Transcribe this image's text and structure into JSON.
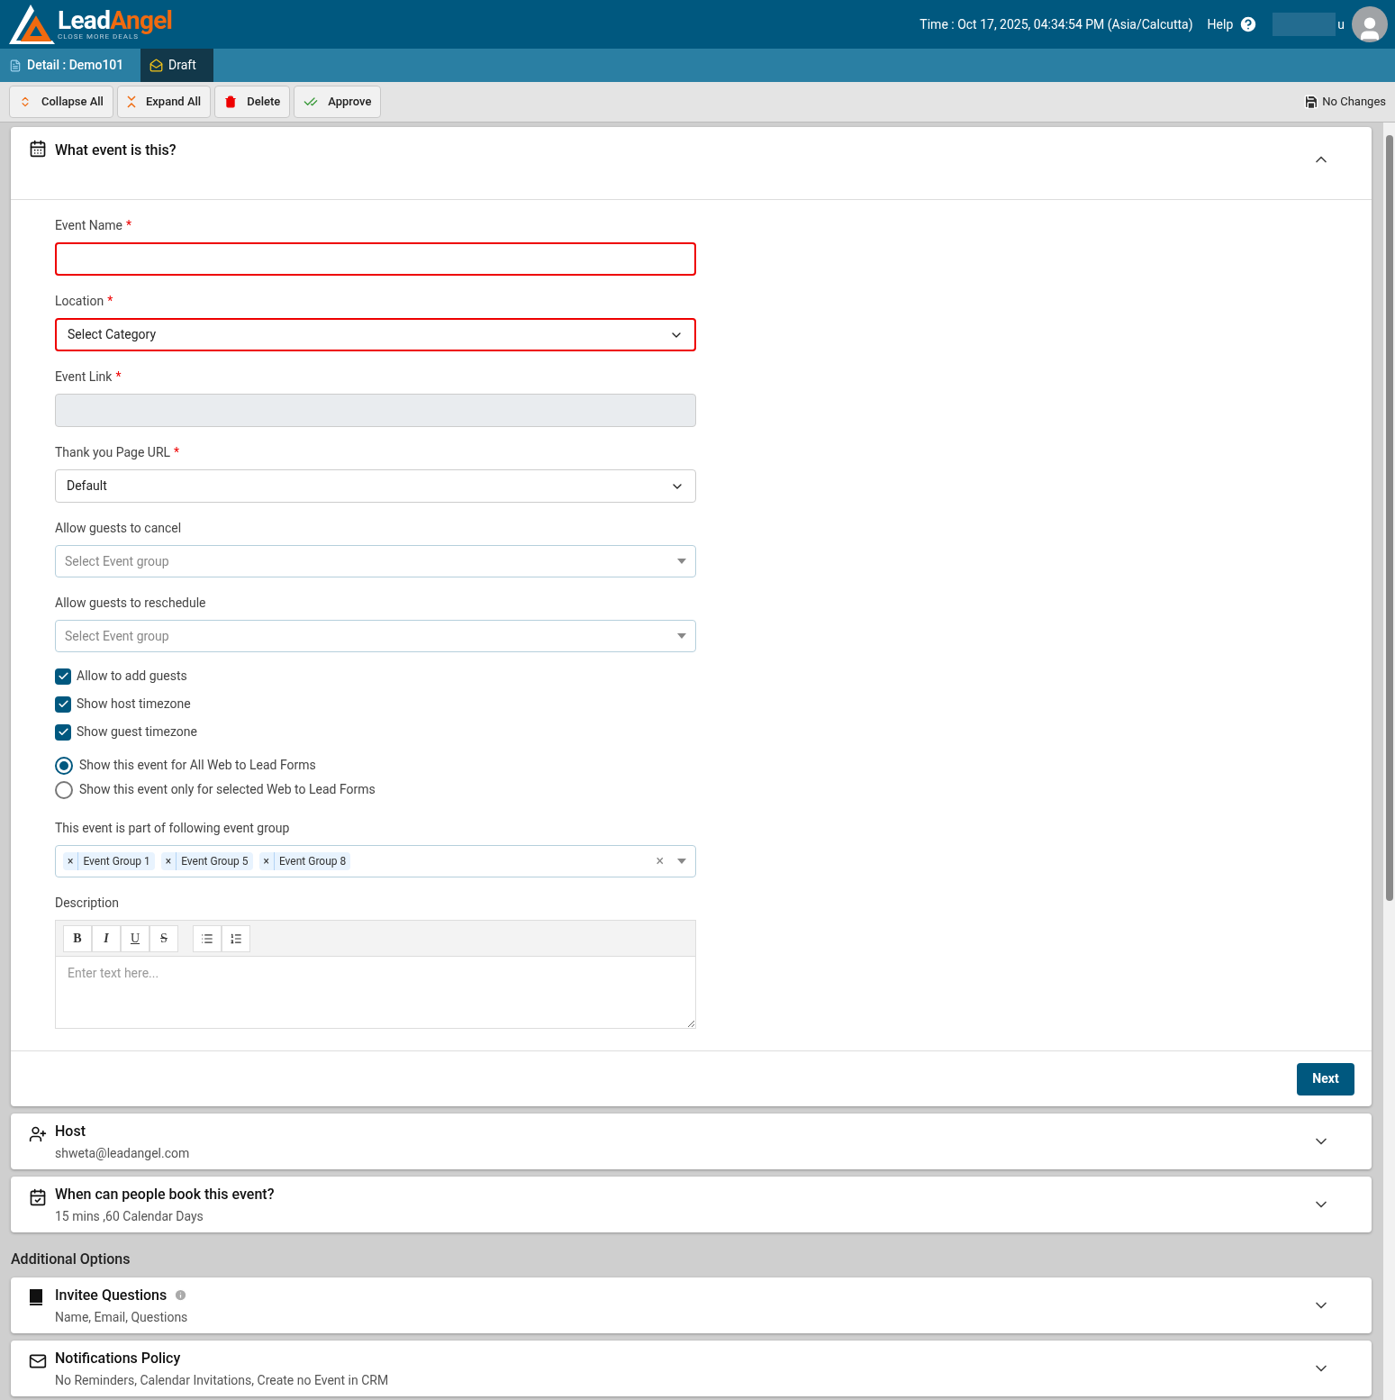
{
  "header": {
    "logo": {
      "word_1": "Lead",
      "word_2": "Angel",
      "tagline": "CLOSE MORE DEALS"
    },
    "time": "Time : Oct 17, 2025, 04:34:54 PM (Asia/Calcutta)",
    "help": "Help",
    "user_name_visible": "u"
  },
  "required_mark": "*",
  "tabs": [
    {
      "label": "Detail : Demo101",
      "kind": "detail",
      "selected": false
    },
    {
      "label": "Draft",
      "kind": "draft",
      "selected": true
    }
  ],
  "toolbar": {
    "buttons": [
      {
        "label": "Collapse All",
        "kind": "collapse"
      },
      {
        "label": "Expand All",
        "kind": "expand"
      },
      {
        "label": "Delete",
        "kind": "delete"
      },
      {
        "label": "Approve",
        "kind": "approve"
      }
    ],
    "status": "No Changes"
  },
  "main_section": {
    "title": "What event is this?",
    "expanded": true,
    "fields": [
      {
        "kind": "text",
        "label": "Event Name",
        "required": true,
        "invalid": true,
        "disabled": false
      },
      {
        "kind": "select",
        "label": "Location",
        "required": true,
        "invalid": true,
        "value": "Select Category"
      },
      {
        "kind": "text",
        "label": "Event Link",
        "required": true,
        "invalid": false,
        "disabled": true
      },
      {
        "kind": "select",
        "label": "Thank you Page URL",
        "required": true,
        "invalid": false,
        "value": "Default"
      },
      {
        "kind": "combo",
        "label": "Allow guests to cancel",
        "required": false,
        "placeholder": "Select Event group"
      },
      {
        "kind": "combo",
        "label": "Allow guests to reschedule",
        "required": false,
        "placeholder": "Select Event group"
      }
    ],
    "checkboxes": [
      {
        "label": "Allow to add guests",
        "checked": true
      },
      {
        "label": "Show host timezone",
        "checked": true
      },
      {
        "label": "Show guest timezone",
        "checked": true
      }
    ],
    "radios": [
      {
        "label": "Show this event for All Web to Lead Forms",
        "selected": true
      },
      {
        "label": "Show this event only for selected Web to Lead Forms",
        "selected": false
      }
    ],
    "event_group": {
      "label": "This event is part of following event group",
      "tags": [
        "Event Group 1",
        "Event Group 5",
        "Event Group 8"
      ],
      "remove_symbol": "×",
      "clear_symbol": "×"
    },
    "description": {
      "label": "Description",
      "format_buttons": [
        {
          "kind": "bold",
          "label": "B"
        },
        {
          "kind": "italic",
          "label": "I"
        },
        {
          "kind": "underline",
          "label": "U"
        },
        {
          "kind": "strike",
          "label": "S"
        }
      ],
      "placeholder": "Enter text here..."
    },
    "next_button": "Next"
  },
  "sections": [
    {
      "kind": "host",
      "title": "Host",
      "summary": "shweta@leadangel.com",
      "info": false
    },
    {
      "kind": "calendar",
      "title": "When can people book this event?",
      "summary": "15 mins ,60 Calendar Days",
      "info": false
    }
  ],
  "additional_heading": "Additional Options",
  "additional_sections": [
    {
      "kind": "questions",
      "title": "Invitee Questions",
      "summary": "Name, Email, Questions",
      "info": true
    },
    {
      "kind": "mail",
      "title": "Notifications Policy",
      "summary": "No Reminders, Calendar Invitations, Create no Event in CRM",
      "info": false
    }
  ]
}
